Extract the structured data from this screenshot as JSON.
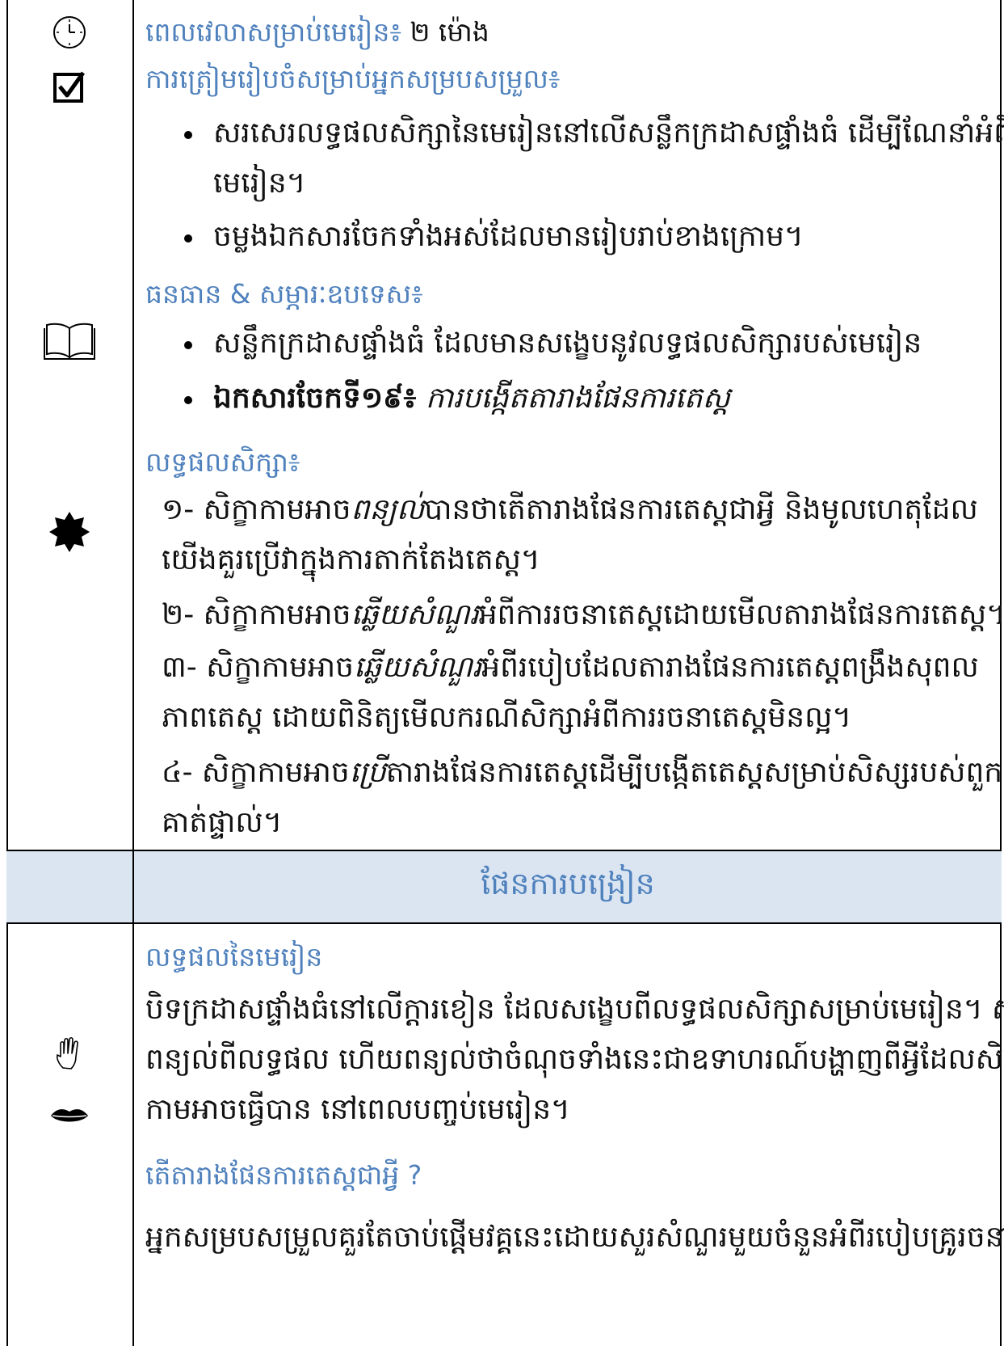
{
  "time": {
    "label": "ពេលវេលាសម្រាប់មេរៀន៖",
    "value": "២ ម៉ោង"
  },
  "preparation": {
    "heading": "ការត្រៀមរៀបចំសម្រាប់អ្នកសម្របសម្រួល៖",
    "bullets": [
      {
        "line1": "សរសេរលទ្ធផលសិក្សានៃមេរៀននៅលើសន្លឹកក្រដាសផ្ទាំងធំ ដើម្បីណែនាំអំពី",
        "line2": "មេរៀន។"
      },
      {
        "line1": "ចម្លងឯកសារចែកទាំងអស់ដែលមានរៀបរាប់ខាងក្រោម។"
      }
    ]
  },
  "resources": {
    "heading": "ធនធាន & សម្ភារៈឧបទេស៖",
    "bullet1": "សន្លឹកក្រដាសផ្ទាំងធំ  ដែលមានសង្ខេបនូវលទ្ធផលសិក្សារបស់មេរៀន",
    "bullet2_bold": "ឯកសារចែកទី១៩៖",
    "bullet2_italic": "ការបង្កើតតារាងផែនការតេស្ត"
  },
  "outcomes": {
    "heading": "លទ្ធផលសិក្សា៖",
    "items": [
      {
        "prefix": "១- សិក្ខាកាមអាច",
        "verb": "ពន្យល់",
        "rest": "បានថាតើតារាងផែនការតេស្តជាអ្វី និងមូលហេតុដែល",
        "line2": "យើងគួរប្រើវាក្នុងការតាក់តែងតេស្ត។"
      },
      {
        "prefix": "២- សិក្ខាកាមអាច",
        "verb": "ឆ្លើយសំណួរ",
        "rest": "អំពីការរចនាតេស្តដោយមើលតារាងផែនការតេស្ត។"
      },
      {
        "prefix": "៣- សិក្ខាកាមអាច",
        "verb": "ឆ្លើយសំណួរ",
        "rest": "អំពីរបៀបដែលតារាងផែនការតេស្តពង្រឹងសុពល",
        "line2": "ភាពតេស្ត ដោយពិនិត្យមើលករណីសិក្សាអំពីការរចនាតេស្តមិនល្អ។"
      },
      {
        "prefix": "៤- សិក្ខាកាមអាច",
        "verb": "ប្រើ",
        "rest": "តារាងផែនការតេស្តដើម្បីបង្កើតតេស្តសម្រាប់សិស្សរបស់ពួក",
        "line2": "គាត់ផ្ទាល់។"
      }
    ]
  },
  "band": {
    "title": "ផែនការបង្រៀន"
  },
  "lesson_outcomes": {
    "heading": "លទ្ធផលនៃមេរៀន",
    "line1": "បិទក្រដាសផ្ទាំងធំនៅលើក្តារខៀន ដែលសង្ខេបពីលទ្ធផលសិក្សាសម្រាប់មេរៀន។ សូម",
    "line2": "ពន្យល់ពីលទ្ធផល ហើយពន្យល់ថាចំណុចទាំងនេះជាឧទាហរណ៍បង្ហាញពីអ្វីដែលសិក្ខា",
    "line3": "កាមអាចធ្វើបាន នៅពេលបញ្ចប់មេរៀន។"
  },
  "what_is": {
    "heading": "តើតារាងផែនការតេស្តជាអ្វី ?",
    "line1": "អ្នកសម្របសម្រួលគួរតែចាប់ផ្តើមវគ្គនេះដោយសួរសំណួរមួយចំនួនអំពីរបៀបគ្រូរចនា"
  },
  "icons": {
    "clock": "clock-icon",
    "checkbox": "checkbox-icon",
    "book": "book-icon",
    "star": "star-burst-icon",
    "hand": "hand-icon",
    "lips": "lips-icon"
  }
}
